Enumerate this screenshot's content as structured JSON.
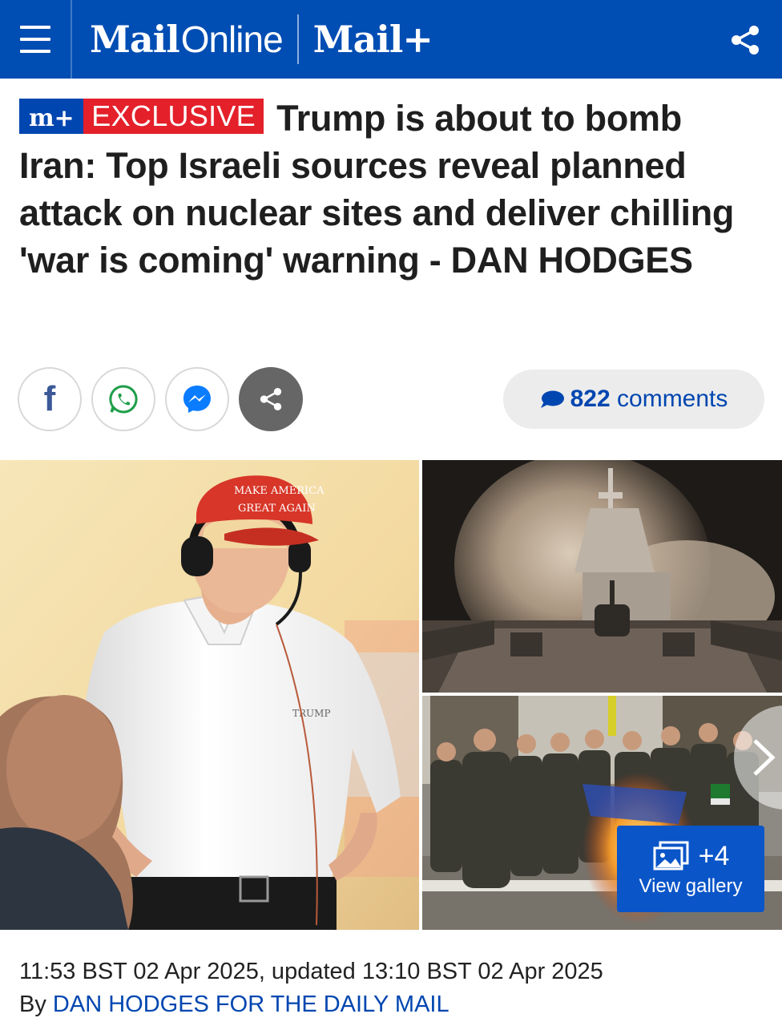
{
  "header": {
    "logo_mail": "Mail",
    "logo_online": "Online",
    "logo_plus": "Mail+"
  },
  "article": {
    "badge_plus": "m+",
    "badge_label": "EXCLUSIVE",
    "headline": "Trump is about to bomb Iran: Top Israeli sources reveal planned attack on nuclear sites and deliver chilling 'war is coming' warning - DAN HODGES",
    "comments_count": "822",
    "comments_label": "comments",
    "gallery_count": "+4",
    "gallery_label": "View gallery",
    "dateline": "11:53 BST 02 Apr 2025, updated 13:10 BST 02 Apr 2025",
    "by_prefix": "By",
    "author": "DAN HODGES FOR THE DAILY MAIL",
    "photo_cap_text_line1": "MAKE AMERICA",
    "photo_cap_text_line2": "GREAT AGAIN",
    "photo_shirt_text": "TRUMP"
  },
  "colors": {
    "brand_blue": "#004db3",
    "exclusive_red": "#e4202a",
    "link_blue": "#0046b0"
  },
  "icons": [
    "menu-icon",
    "share-icon",
    "facebook-icon",
    "whatsapp-icon",
    "messenger-icon",
    "comment-icon",
    "gallery-icon",
    "chevron-right-icon"
  ]
}
